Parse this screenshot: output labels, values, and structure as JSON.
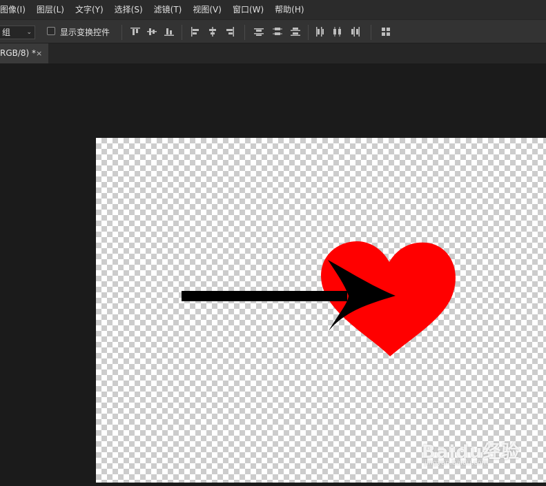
{
  "menu": [
    {
      "label": "图像(I)"
    },
    {
      "label": "图层(L)"
    },
    {
      "label": "文字(Y)"
    },
    {
      "label": "选择(S)"
    },
    {
      "label": "滤镜(T)"
    },
    {
      "label": "视图(V)"
    },
    {
      "label": "窗口(W)"
    },
    {
      "label": "帮助(H)"
    }
  ],
  "options": {
    "auto_select_value": "组",
    "show_transform_label": "显示变换控件",
    "show_transform_checked": false,
    "align_icons": [
      "align-top-edges-icon",
      "align-vertical-centers-icon",
      "align-bottom-edges-icon",
      "align-left-edges-icon",
      "align-horizontal-centers-icon",
      "align-right-edges-icon",
      "distribute-top-edges-icon",
      "distribute-vertical-centers-icon",
      "distribute-bottom-edges-icon",
      "distribute-left-edges-icon",
      "distribute-horizontal-centers-icon",
      "distribute-right-edges-icon",
      "auto-align-layers-icon"
    ]
  },
  "document_tab": {
    "title": "RGB/8) *",
    "close": "×"
  },
  "canvas": {
    "shapes": [
      "arrow",
      "heart"
    ],
    "colors": {
      "heart": "#ff0000",
      "arrow": "#000000"
    }
  },
  "watermark": {
    "main": "Baidu经验",
    "sub": "jingyan.baidu.com"
  }
}
